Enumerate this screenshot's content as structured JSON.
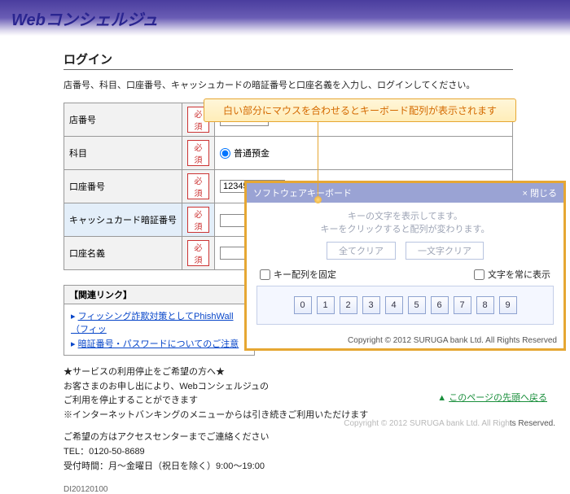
{
  "header": {
    "logo_prefix": "Web",
    "logo_rest": "コンシェルジュ"
  },
  "page": {
    "title": "ログイン",
    "intro": "店番号、科目、口座番号、キャッシュカードの暗証番号と口座名義を入力し、ログインしてください。"
  },
  "form": {
    "required_badge": "必須",
    "rows": [
      {
        "label": "店番号",
        "value": ""
      },
      {
        "label": "科目",
        "radio_label": "普通預金"
      },
      {
        "label": "口座番号",
        "value": "12345"
      },
      {
        "label": "キャッシュカード暗証番号",
        "kbd_link": "ソフトウェアキーボード"
      },
      {
        "label": "口座名義"
      }
    ]
  },
  "callout": "白い部分にマウスを合わせるとキーボード配列が表示されます",
  "related": {
    "title": "【関連リンク】",
    "items": [
      "フィッシング詐欺対策としてPhishWall（フィッ",
      "暗証番号・パスワードについてのご注意"
    ]
  },
  "notes": {
    "l1": "★サービスの利用停止をご希望の方へ★",
    "l2": "お客さまのお申し出により、Webコンシェルジュの",
    "l3": "ご利用を停止することができます",
    "l4": "※インターネットバンキングのメニューからは引き続きご利用いただけます",
    "l5": "ご希望の方はアクセスセンターまでご連絡ください",
    "l6": "TEL：0120-50-8689",
    "l7": "受付時間：月～金曜日（祝日を除く）9:00～19:00"
  },
  "skb": {
    "title": "ソフトウェアキーボード",
    "close": "× 閉じる",
    "msg1": "キーの文字を表示してます。",
    "msg2": "キーをクリックすると配列が変わります。",
    "btn_clear_all": "全てクリア",
    "btn_clear_one": "一文字クリア",
    "chk_fix": "キー配列を固定",
    "chk_show": "文字を常に表示",
    "keys": [
      "0",
      "1",
      "2",
      "3",
      "4",
      "5",
      "6",
      "7",
      "8",
      "9"
    ],
    "copy": "Copyright © 2012 SURUGA bank Ltd. All Rights Reserved"
  },
  "footer": {
    "pageid": "DI20120100",
    "back_top": "このページの先頭へ戻る",
    "copy_light": "Copyright © 2012 SURUGA bank Ltd. All Righ",
    "copy_dark": "ts Reserved."
  }
}
